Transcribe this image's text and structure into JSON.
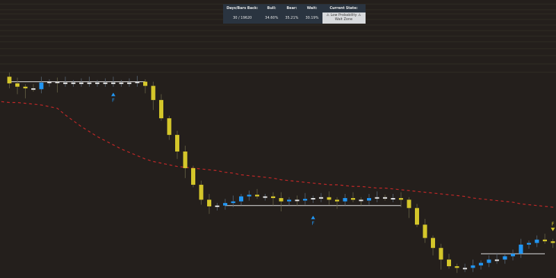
{
  "stats_table": {
    "headers": [
      "Days/Bars Back:",
      "Bull:",
      "Bear:",
      "Wait:",
      "Current State:"
    ],
    "values": [
      "30 / 19620",
      "34.60%",
      "35.21%",
      "30.19%"
    ],
    "state_line1": "⚠ Low Probability ⚠",
    "state_line2": "Wait Zone"
  },
  "colors": {
    "background": "#241f1c",
    "bull": "#2196f3",
    "bear": "#d4c62a",
    "neutral": "#e8e8e8",
    "ma_line": "#c62828",
    "grid": "#4a4438"
  },
  "markers": [
    {
      "label": "F",
      "direction": "up"
    },
    {
      "label": "F",
      "direction": "up"
    },
    {
      "label": "F",
      "direction": "down"
    }
  ],
  "chart_data": {
    "type": "candlestick",
    "price": [
      2,
      10,
      14,
      16,
      17,
      9,
      8,
      9,
      9,
      9,
      9,
      9,
      9,
      9,
      9,
      9,
      9,
      8,
      13,
      30,
      52,
      72,
      92,
      112,
      132,
      150,
      158,
      157,
      154,
      152,
      146,
      144,
      146,
      146,
      148,
      152,
      150,
      151,
      149,
      148,
      147,
      150,
      152,
      148,
      150,
      151,
      148,
      147,
      148,
      148,
      150,
      160,
      180,
      196,
      208,
      222,
      230,
      232,
      232,
      229,
      226,
      222,
      222,
      218,
      215,
      204,
      202,
      198,
      200,
      202,
      197
    ],
    "ma": [
      32,
      33,
      33,
      34,
      35,
      36,
      38,
      40,
      48,
      55,
      62,
      68,
      74,
      79,
      84,
      89,
      93,
      97,
      101,
      104,
      106,
      108,
      110,
      111,
      112,
      113,
      114,
      115,
      117,
      118,
      120,
      121,
      122,
      123,
      124,
      126,
      127,
      128,
      129,
      130,
      131,
      132,
      132,
      133,
      134,
      134,
      135,
      136,
      136,
      137,
      138,
      139,
      140,
      141,
      142,
      143,
      144,
      145,
      146,
      148,
      149,
      150,
      151,
      152,
      153,
      155,
      156,
      157,
      158,
      159,
      159
    ],
    "levels": [
      {
        "value": 8,
        "from": 1,
        "to": 18
      },
      {
        "value": 157,
        "from": 28,
        "to": 50
      },
      {
        "value": 215,
        "from": 60,
        "to": 68
      }
    ]
  }
}
